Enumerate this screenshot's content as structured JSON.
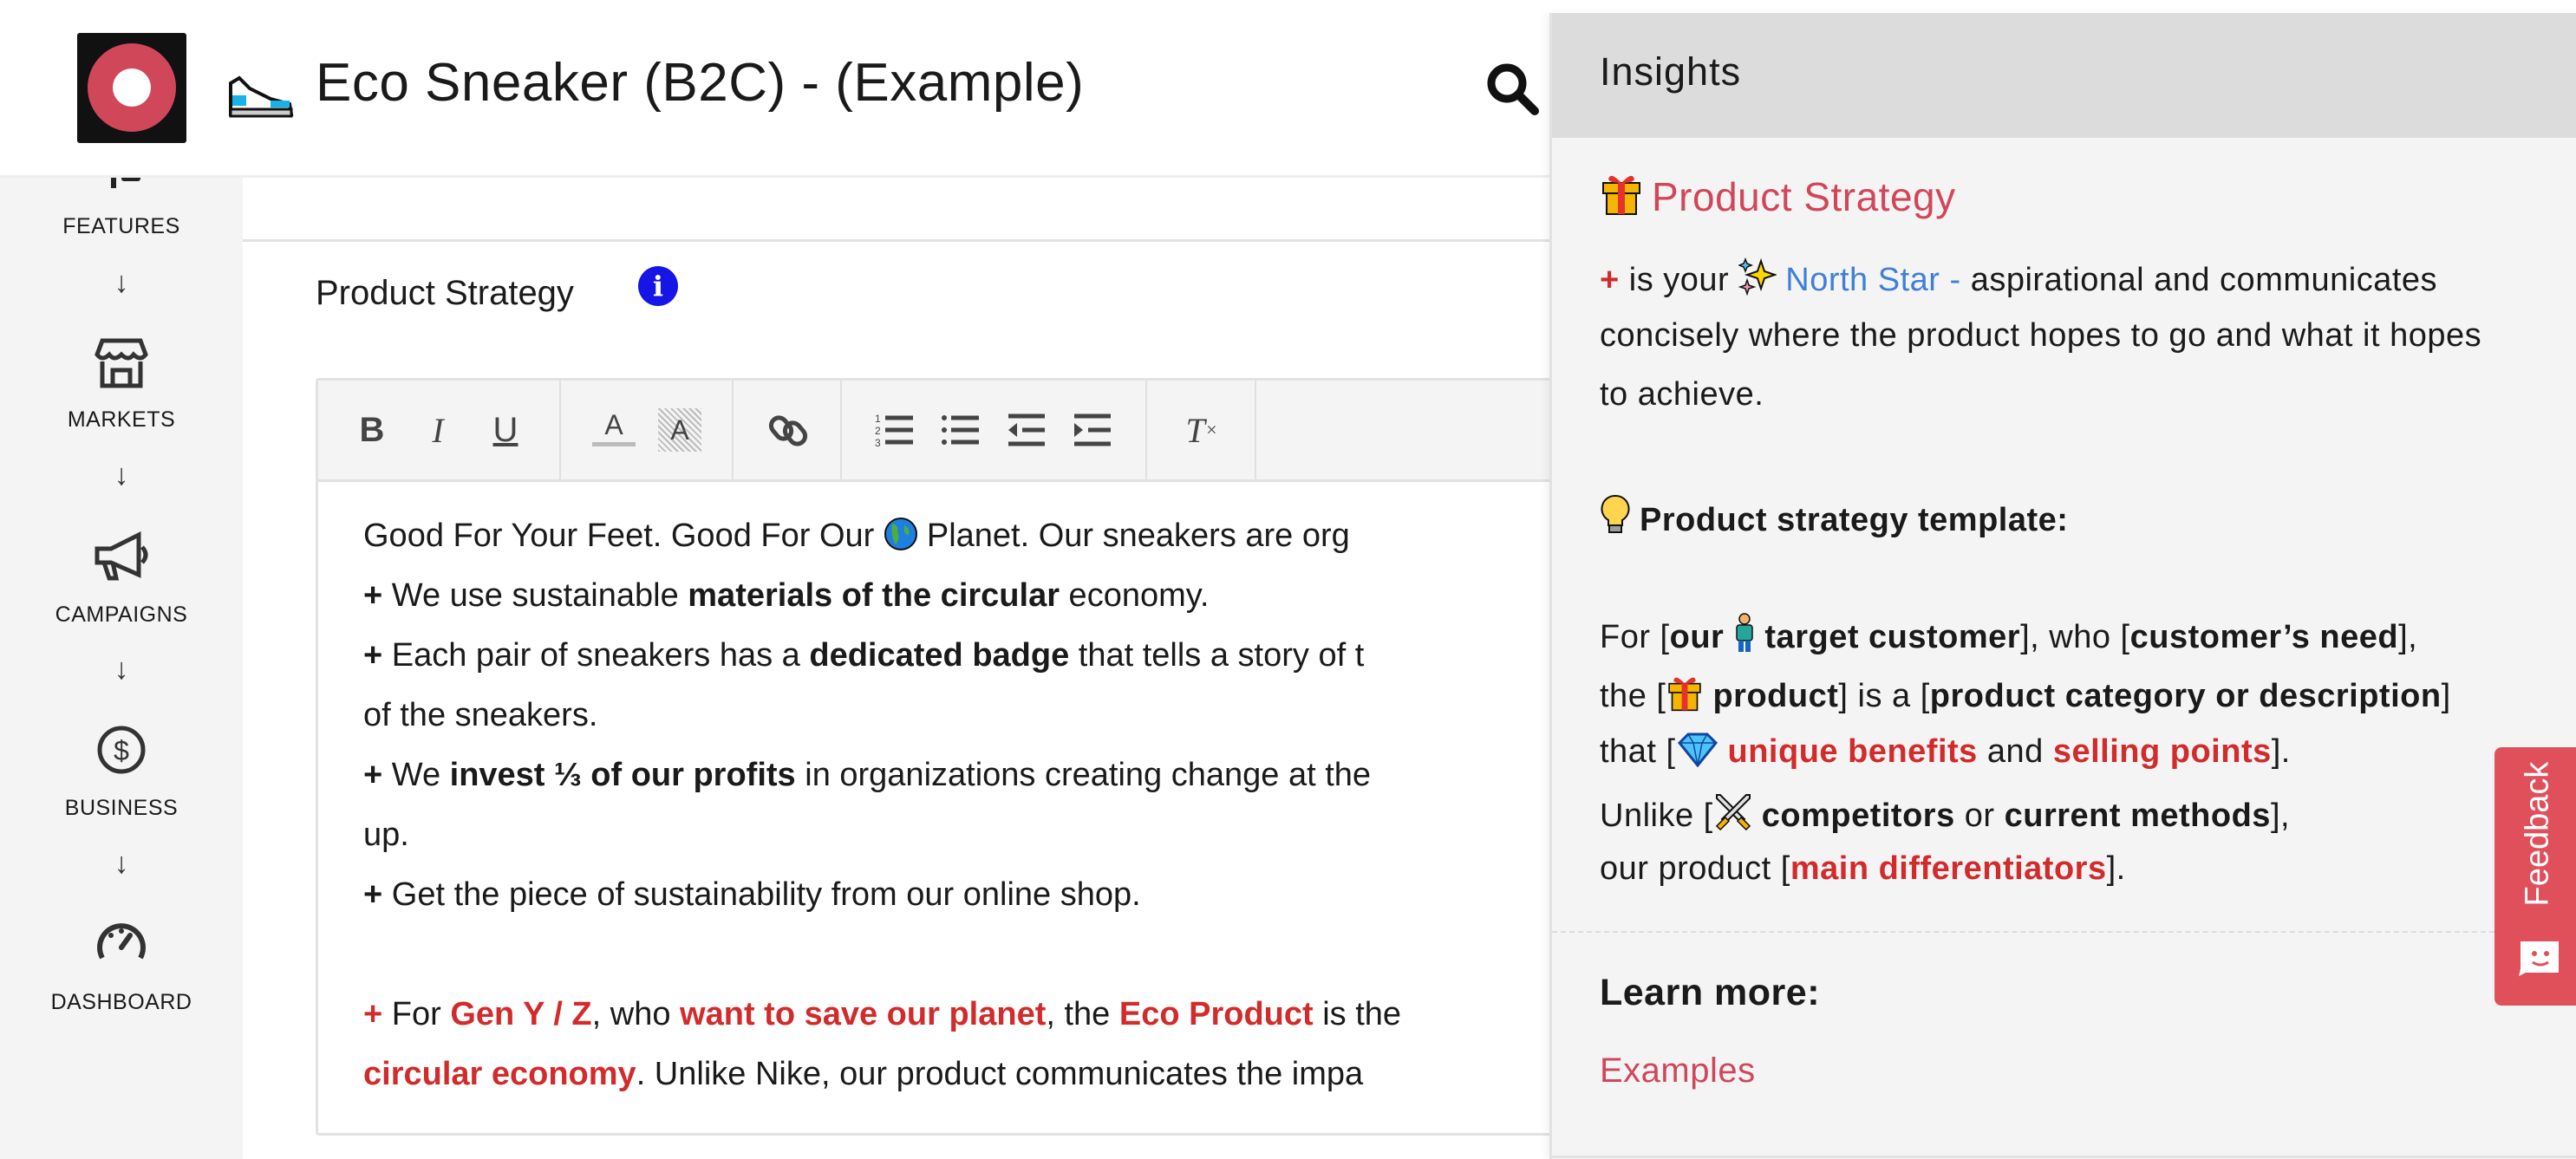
{
  "header": {
    "title": "Eco Sneaker (B2C) - (Example)",
    "brand_color": "#d0475a",
    "icons": [
      "logo",
      "sneaker-emoji",
      "search-icon"
    ]
  },
  "sidebar": {
    "items": [
      {
        "label": "FEATURES",
        "icon": "list-icon"
      },
      {
        "label": "MARKETS",
        "icon": "store-icon"
      },
      {
        "label": "CAMPAIGNS",
        "icon": "megaphone-icon"
      },
      {
        "label": "BUSINESS",
        "icon": "dollar-circle-icon"
      },
      {
        "label": "DASHBOARD",
        "icon": "gauge-icon"
      }
    ],
    "arrow": "↓"
  },
  "main": {
    "section_title": "Product Strategy",
    "info_icon": "i",
    "toolbar": {
      "bold": "B",
      "italic": "I",
      "underline": "U",
      "font_color": "A",
      "highlight": "A",
      "clear_format": "T"
    },
    "editor": {
      "l1a": "Good For Your Feet. Good For Our",
      "l1b": "Planet. Our sneakers are org",
      "plus": "+",
      "l2a": " We use sustainable ",
      "l2b": "materials of the circular",
      "l2c": " economy.",
      "l3a": " Each pair of sneakers has a ",
      "l3b": "dedicated badge",
      "l3c": " that tells a story of t",
      "l4": "of the sneakers.",
      "l5a": " We ",
      "l5b": "invest ⅓ of our profits",
      "l5c": " in organizations creating change at the",
      "l6": "up.",
      "l7": " Get the piece of sustainability from our online shop.",
      "l8a": " For ",
      "l8b": "Gen Y / Z",
      "l8c": ", who ",
      "l8d": "want to save our planet",
      "l8e": ", the ",
      "l8f": "Eco Product",
      "l8g": " is the",
      "l9a": "circular economy",
      "l9b": ". Unlike Nike, our product communicates the impa"
    }
  },
  "insights": {
    "title": "Insights",
    "heading": "Product Strategy",
    "p1a": "+",
    "p1b": " is your ",
    "p1c": "North Star -",
    "p1d": " aspirational and communicates",
    "p2": "concisely where the product hopes to go and what it hopes",
    "p3": "to achieve.",
    "template_title": "Product strategy template:",
    "t1": [
      "For [",
      "our",
      "target customer",
      "], who [",
      "customer’s need",
      "],"
    ],
    "t2": [
      "the [",
      "product",
      "] is a [",
      "product category or description",
      "]"
    ],
    "t3": [
      "that [",
      "unique benefits",
      " and ",
      "selling points",
      "]."
    ],
    "t4": [
      "Unlike [",
      "competitors",
      " or ",
      "current methods",
      "],"
    ],
    "t5": [
      "our product [",
      "main differentiators",
      "]."
    ],
    "learn_more": "Learn more:",
    "examples_link": "Examples",
    "colors": {
      "heading": "#d0475a",
      "highlight": "#d22b2b",
      "link_blue": "#3f7fd8"
    }
  },
  "feedback": {
    "label": "Feedback",
    "color": "#e0505a"
  }
}
